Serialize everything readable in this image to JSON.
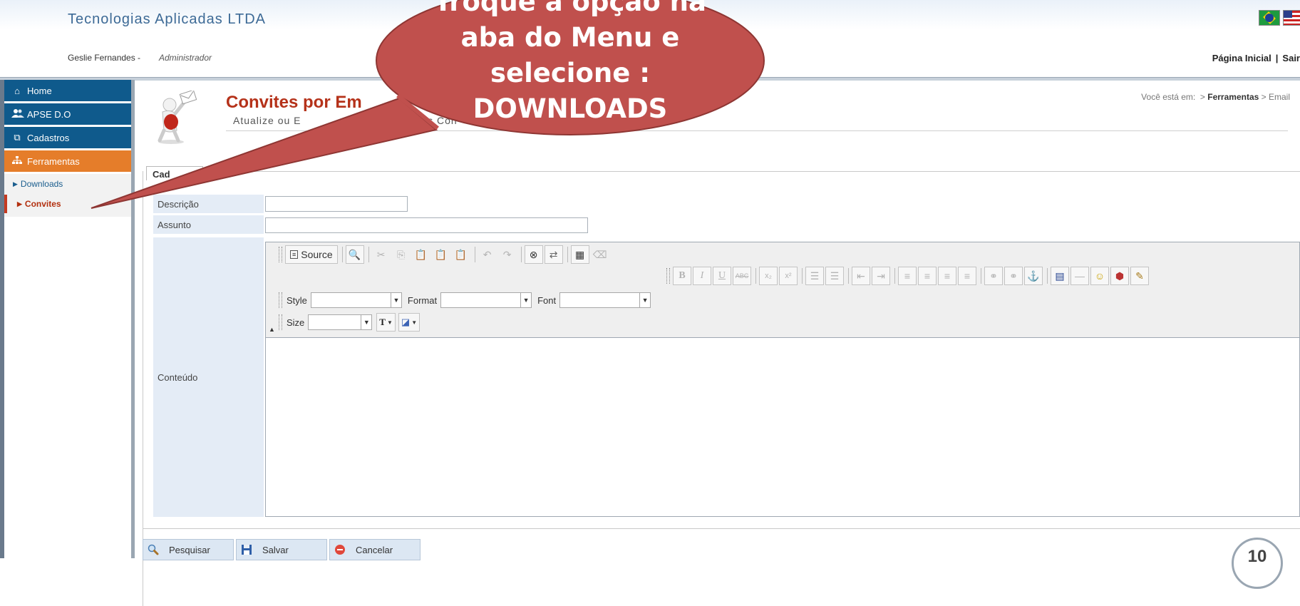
{
  "header": {
    "company": "Tecnologias Aplicadas LTDA",
    "user_name": "Geslie Fernandes -",
    "user_role": "Administrador",
    "link_home": "Página Inicial",
    "link_sep": "|",
    "link_exit": "Sair"
  },
  "sidebar": {
    "items": [
      {
        "label": "Home",
        "icon": "home-icon"
      },
      {
        "label": "APSE D.O",
        "icon": "users-icon"
      },
      {
        "label": "Cadastros",
        "icon": "copy-icon"
      },
      {
        "label": "Ferramentas",
        "icon": "sitemap-icon"
      }
    ],
    "submenu": [
      {
        "label": "Downloads"
      },
      {
        "label": "Convites"
      }
    ]
  },
  "page": {
    "title": "Convites por Em",
    "subtitle": "Atualize ou E",
    "subtitle_tail": "dos Con",
    "breadcrumb_prefix": "Você está em:",
    "breadcrumb_arrow": ">",
    "breadcrumb_section": "Ferramentas",
    "breadcrumb_current": "> Email",
    "tab_label": "Cad"
  },
  "form": {
    "descricao_label": "Descrição",
    "descricao_value": "",
    "assunto_label": "Assunto",
    "assunto_value": "",
    "conteudo_label": "Conteúdo"
  },
  "editor": {
    "source_label": "Source",
    "style_label": "Style",
    "format_label": "Format",
    "font_label": "Font",
    "size_label": "Size",
    "style_value": "",
    "format_value": "",
    "font_value": "",
    "size_value": ""
  },
  "actions": {
    "search": "Pesquisar",
    "save": "Salvar",
    "cancel": "Cancelar"
  },
  "callout": {
    "line1": "Troque a opção na",
    "line2": "aba do Menu e",
    "line3": "selecione :",
    "line4": "DOWNLOADS"
  },
  "slide_number": "10",
  "colors": {
    "menu_blue": "#0f5a8c",
    "menu_orange": "#e57d2a",
    "title_red": "#b5321a",
    "callout_fill": "#c0504d"
  }
}
